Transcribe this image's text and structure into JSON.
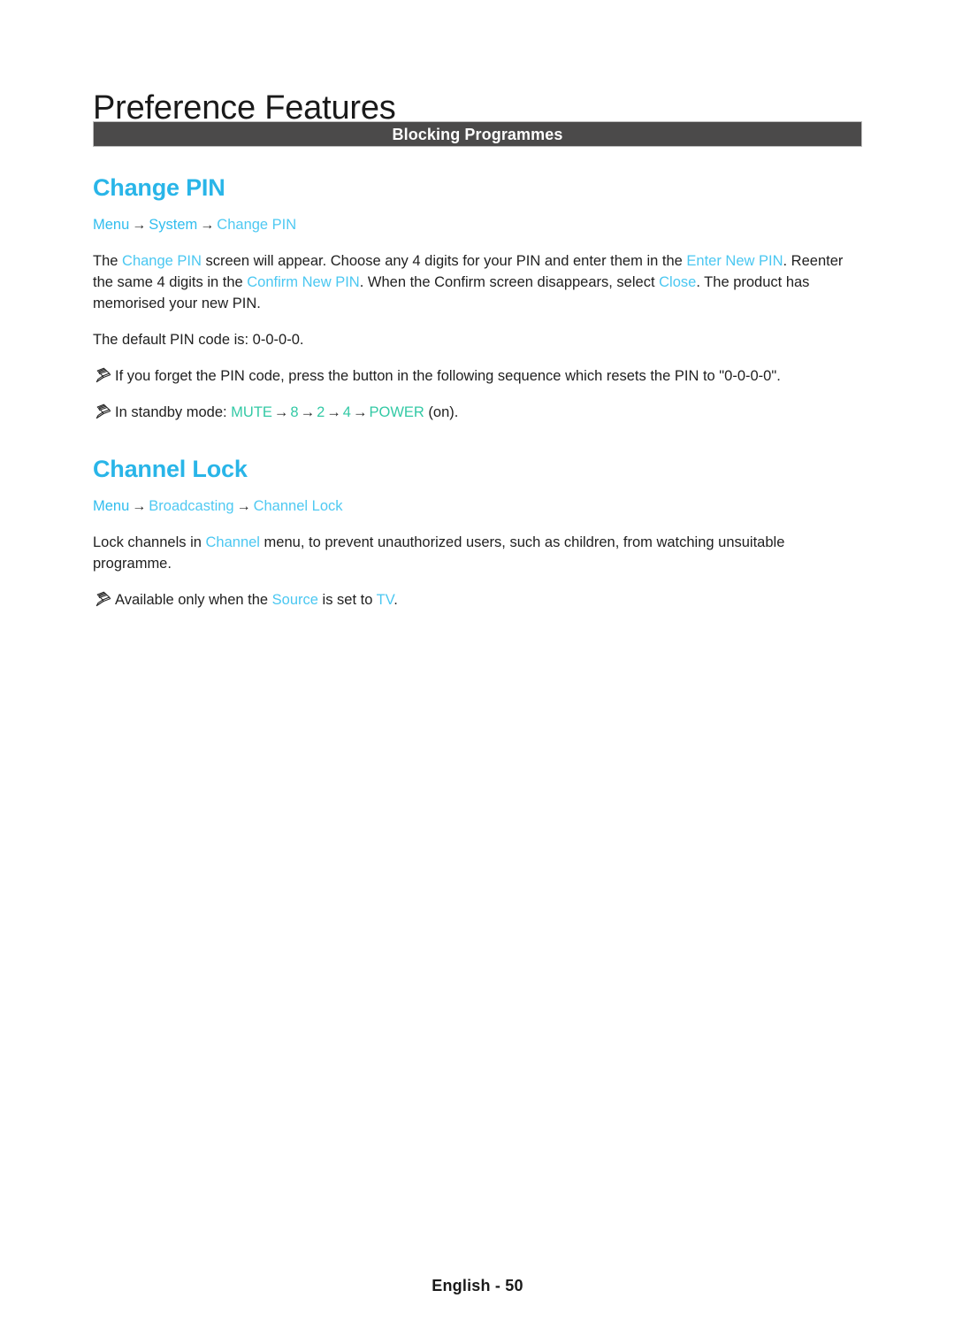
{
  "page": {
    "chapter_title": "Preference Features",
    "section_banner": "Blocking Programmes",
    "footer": "English - 50",
    "colors": {
      "heading_cyan": "#29b5e8",
      "link_cyan": "#4ac7f1",
      "sequence_teal": "#33c9a5",
      "banner_background": "#4b4a4a",
      "body_text": "#1f1f1f"
    }
  },
  "topics": [
    {
      "heading": "Change PIN",
      "breadcrumb": {
        "items": [
          "Menu",
          "System",
          "Change PIN"
        ],
        "separator": "→"
      },
      "paragraph": {
        "p1_a": "The ",
        "p1_link1": "Change PIN",
        "p1_b": " screen will appear. Choose any 4 digits for your PIN and enter them in the ",
        "p1_link2": "Enter New PIN",
        "p1_c": ". Reenter the same 4 digits in the ",
        "p1_link3": "Confirm New PIN",
        "p1_d": ". When the Confirm screen disappears, select ",
        "p1_link4": "Close",
        "p1_e": ". The product has memorised your new PIN."
      },
      "default_pin_line": "The default PIN code is: 0-0-0-0.",
      "notes": [
        {
          "icon": "pencil-note-icon",
          "text": "If you forget the PIN code, press the button in the following sequence which resets the PIN to \"0-0-0-0\"."
        },
        {
          "icon": "pencil-note-icon",
          "prefix": "In standby mode: ",
          "sequence": [
            "MUTE",
            "8",
            "2",
            "4",
            "POWER"
          ],
          "sequence_separator": "→",
          "suffix": " (on)."
        }
      ]
    },
    {
      "heading": "Channel Lock",
      "breadcrumb": {
        "items": [
          "Menu",
          "Broadcasting",
          "Channel Lock"
        ],
        "separator": "→"
      },
      "paragraph": {
        "p1_a": "Lock channels in ",
        "p1_link1": "Channel",
        "p1_b": " menu, to prevent unauthorized users, such as children, from watching unsuitable programme."
      },
      "notes": [
        {
          "icon": "pencil-note-icon",
          "a": "Available only when the ",
          "link1": "Source",
          "b": " is set to ",
          "link2": "TV",
          "c": "."
        }
      ]
    }
  ]
}
